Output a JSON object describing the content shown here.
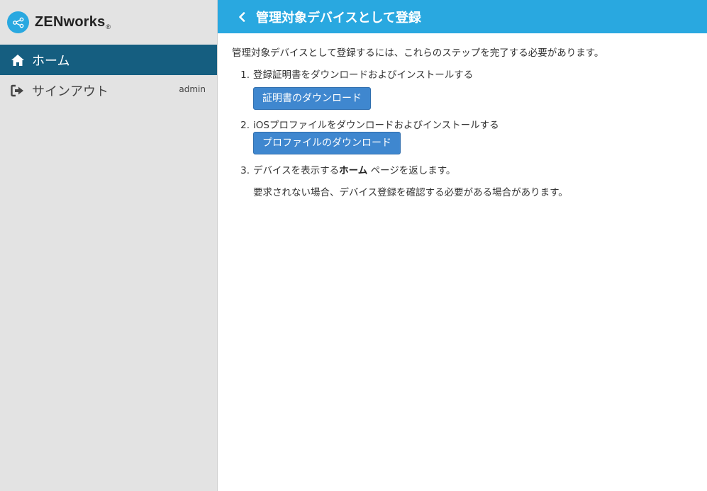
{
  "brand": {
    "name": "ZENworks",
    "reg": "®"
  },
  "sidebar": {
    "items": [
      {
        "label": "ホーム",
        "icon": "home-icon"
      },
      {
        "label": "サインアウト",
        "icon": "sign-out-icon",
        "user": "admin"
      }
    ]
  },
  "header": {
    "title": "管理対象デバイスとして登録"
  },
  "content": {
    "intro": "管理対象デバイスとして登録するには、これらのステップを完了する必要があります。",
    "steps": [
      {
        "num": "1.",
        "text": "登録証明書をダウンロードおよびインストールする",
        "button": "証明書のダウンロード"
      },
      {
        "num": "2.",
        "text": "iOSプロファイルをダウンロードおよびインストールする",
        "button": "プロファイルのダウンロード"
      },
      {
        "num": "3.",
        "text_pre": "デバイスを表示する",
        "text_strong": "ホーム",
        "text_post": " ページを返します。",
        "note": "要求されない場合、デバイス登録を確認する必要がある場合があります。"
      }
    ]
  },
  "colors": {
    "header": "#29a8e0",
    "active_nav": "#155e80",
    "button": "#3f87cf",
    "sidebar_bg": "#e3e3e3"
  }
}
